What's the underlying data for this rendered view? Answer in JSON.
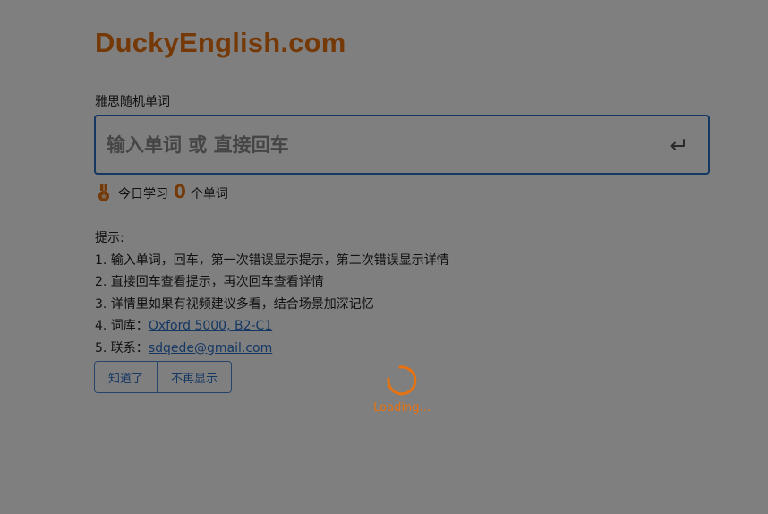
{
  "brand": {
    "title": "DuckyEnglish.com"
  },
  "input": {
    "label": "雅思随机单词",
    "placeholder": "输入单词 或 直接回车",
    "submit_icon": "enter-return-icon"
  },
  "stats": {
    "prefix": "今日学习",
    "count": "0",
    "suffix": "个单词",
    "icon": "medal-icon"
  },
  "tips": {
    "heading": "提示:",
    "items": [
      "1. 输入单词，回车，第一次错误显示提示，第二次错误显示详情",
      "2. 直接回车查看提示，再次回车查看详情",
      "3. 详情里如果有视频建议多看，结合场景加深记忆"
    ],
    "vocab_prefix": "4. 词库：",
    "vocab_link": "Oxford 5000, B2-C1",
    "contact_prefix": "5. 联系：",
    "contact_link": "sdqede@gmail.com"
  },
  "buttons": {
    "ok": "知道了",
    "never_show": "不再显示"
  },
  "loading": {
    "text": "Loading..."
  },
  "colors": {
    "accent": "#e8720f",
    "primary": "#2a6fc6",
    "overlay": "rgba(0,0,0,0.5)"
  }
}
